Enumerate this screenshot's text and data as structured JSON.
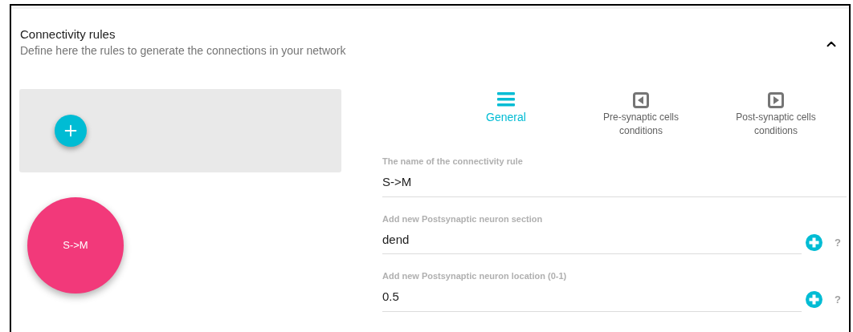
{
  "panel": {
    "title": "Connectivity rules",
    "subtitle": "Define here the rules to generate the connections in your network",
    "expanded": true
  },
  "rules": [
    {
      "label": "S->M"
    }
  ],
  "tabs": [
    {
      "label": "General",
      "kind": "menu",
      "selected": true
    },
    {
      "label": "Pre-synaptic cells conditions",
      "kind": "left",
      "selected": false
    },
    {
      "label": "Post-synaptic cells conditions",
      "kind": "right",
      "selected": false
    }
  ],
  "fields": [
    {
      "kind": "text",
      "label": "The name of the connectivity rule",
      "value": "S->M"
    },
    {
      "kind": "addable",
      "label": "Add new Postsynaptic neuron section",
      "value": "dend",
      "help": "?"
    },
    {
      "kind": "addable",
      "label": "Add new Postsynaptic neuron location (0-1)",
      "value": "0.5",
      "help": "?"
    }
  ]
}
